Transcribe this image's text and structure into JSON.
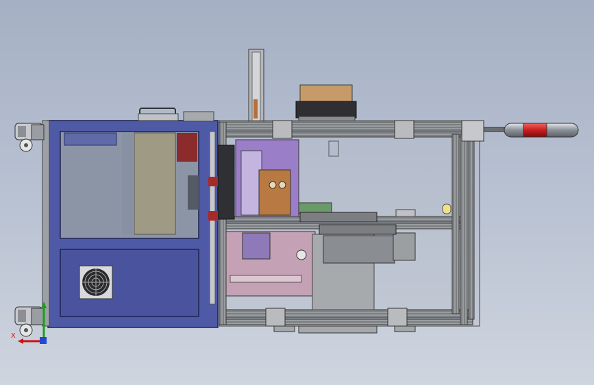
{
  "triad": {
    "x_label": "X"
  },
  "colors": {
    "cabinet_blue": "#4f5aa6",
    "frame_steel": "#8f9295",
    "machine_pink": "#c4a1b4",
    "purple_block": "#9a7ec8",
    "copper_block": "#b87a42",
    "box_tan": "#c79a6a",
    "handle_red": "#c81f1f"
  }
}
